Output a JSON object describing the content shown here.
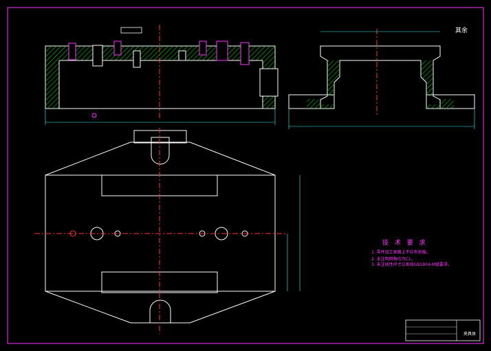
{
  "drawing": {
    "roughness_note": "其余",
    "tech_requirements": {
      "title": "技 术 要 求",
      "items": [
        "1. 零件加工表面上不应有划痕。",
        "2. 未注明倒角均为C1。",
        "3. 未注线性尺寸公差按GB1804-M级要求。"
      ]
    },
    "title_block": {
      "part_name": "夹具体"
    },
    "colors": {
      "background": "#000000",
      "outline": "#ffffff",
      "frame": "#ff33ff",
      "hatch": "#00cc00",
      "centerline": "#ff3333",
      "dimension": "#33ffff",
      "note": "#ff33ff"
    }
  }
}
